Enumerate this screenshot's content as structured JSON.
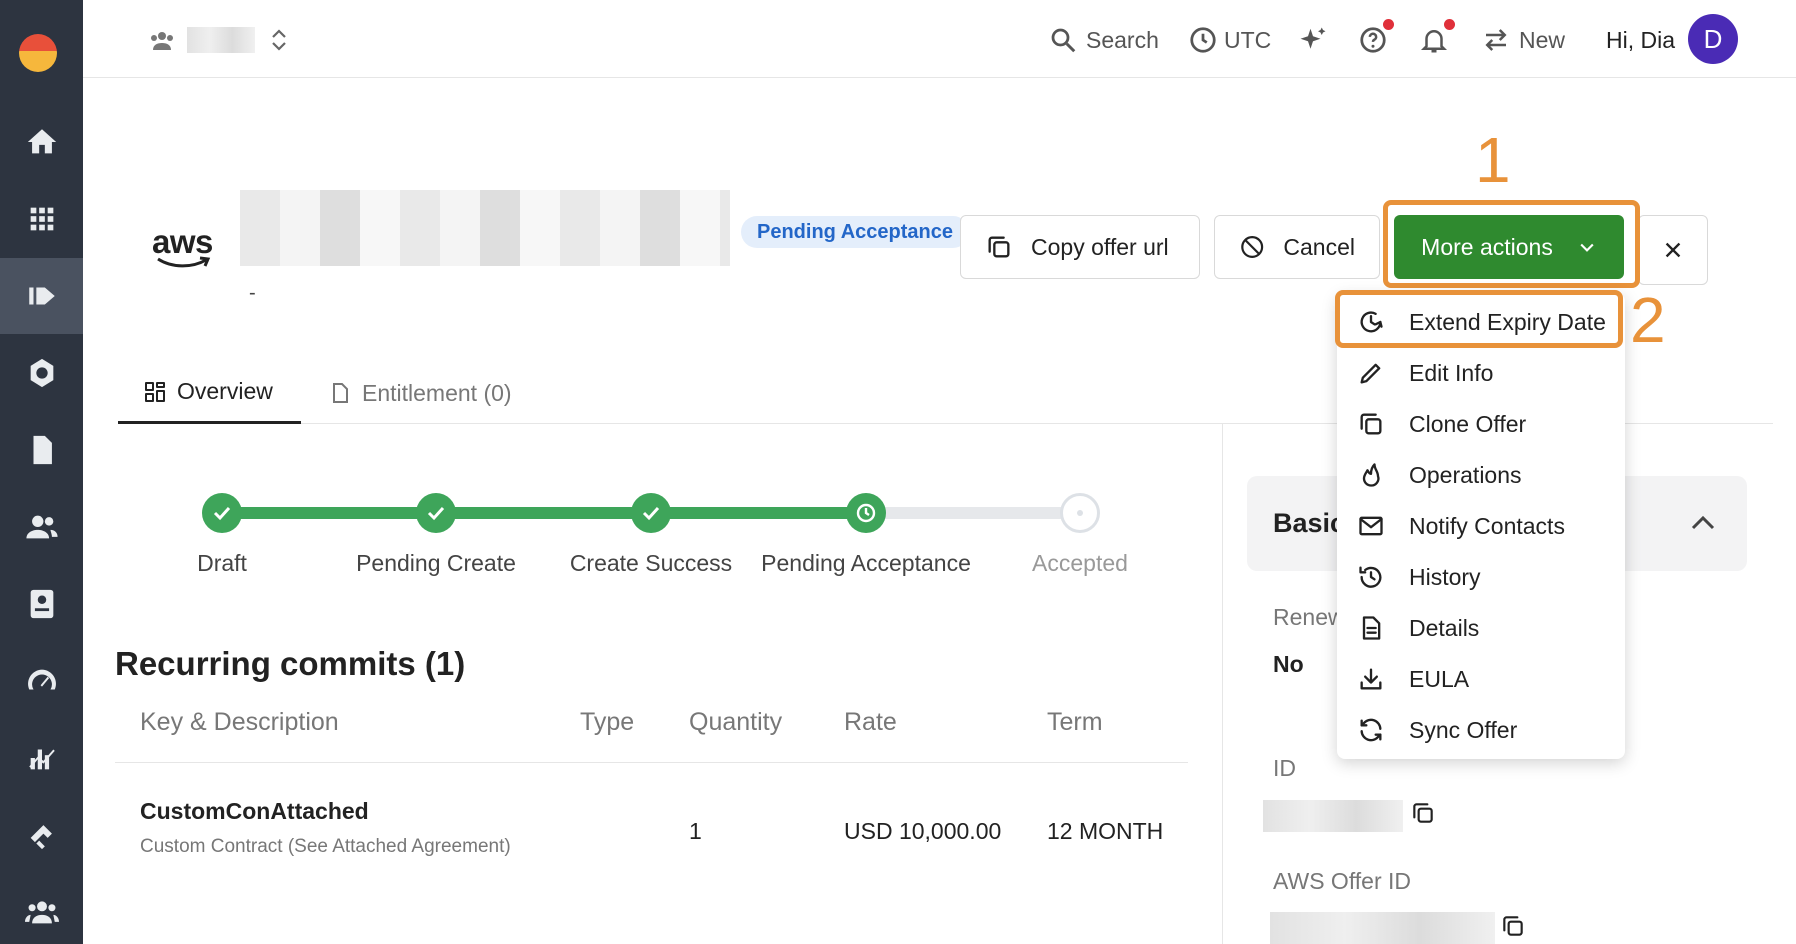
{
  "topbar": {
    "search_label": "Search",
    "timezone_label": "UTC",
    "new_label": "New",
    "greeting": "Hi, Dia",
    "avatar_initial": "D"
  },
  "offer": {
    "vendor_logo_text": "aws",
    "subtitle": "-",
    "status": "Pending Acceptance"
  },
  "actions": {
    "copy_url": "Copy offer url",
    "cancel": "Cancel",
    "more_actions": "More actions"
  },
  "annotations": {
    "first": "1",
    "second": "2"
  },
  "dropdown": {
    "items": [
      {
        "label": "Extend Expiry Date",
        "icon": "clock-arrow-icon"
      },
      {
        "label": "Edit Info",
        "icon": "pencil-icon"
      },
      {
        "label": "Clone Offer",
        "icon": "copy-icon"
      },
      {
        "label": "Operations",
        "icon": "flame-icon"
      },
      {
        "label": "Notify Contacts",
        "icon": "mail-icon"
      },
      {
        "label": "History",
        "icon": "history-icon"
      },
      {
        "label": "Details",
        "icon": "document-icon"
      },
      {
        "label": "EULA",
        "icon": "download-icon"
      },
      {
        "label": "Sync Offer",
        "icon": "sync-icon"
      }
    ]
  },
  "tabs": [
    {
      "label": "Overview",
      "active": true
    },
    {
      "label": "Entitlement (0)",
      "active": false
    }
  ],
  "progress": {
    "steps": [
      {
        "label": "Draft",
        "state": "done"
      },
      {
        "label": "Pending Create",
        "state": "done"
      },
      {
        "label": "Create Success",
        "state": "done"
      },
      {
        "label": "Pending Acceptance",
        "state": "current"
      },
      {
        "label": "Accepted",
        "state": "todo"
      }
    ]
  },
  "commits": {
    "title": "Recurring commits (1)",
    "columns": [
      "Key & Description",
      "Type",
      "Quantity",
      "Rate",
      "Term"
    ],
    "rows": [
      {
        "key": "CustomConAttached",
        "description": "Custom Contract (See Attached Agreement)",
        "type": "",
        "quantity": "1",
        "rate": "USD 10,000.00",
        "term": "12 MONTH"
      }
    ]
  },
  "basic_panel": {
    "title": "Basic",
    "renew_label": "Renew",
    "renew_value": "No",
    "id_label": "ID",
    "aws_offer_id_label": "AWS Offer ID"
  },
  "colors": {
    "sidebar": "#2d3440",
    "primary": "#2f8a2f",
    "accent_annotation": "#e8923a",
    "status_badge_text": "#2366c8",
    "step_done": "#3ea55a"
  }
}
